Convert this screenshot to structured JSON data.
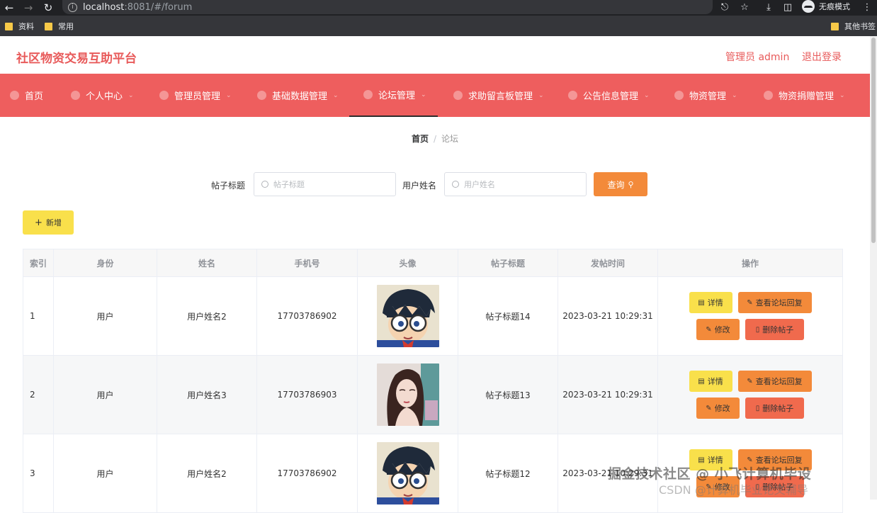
{
  "browser": {
    "url_host": "localhost",
    "url_path": ":8081/#/forum",
    "incognito_label": "无痕模式",
    "bookmarks": [
      "资料",
      "常用"
    ],
    "other_bookmarks": "其他书签"
  },
  "header": {
    "title": "社区物资交易互助平台",
    "admin": "管理员 admin",
    "logout": "退出登录",
    "accent": "#e85a5a"
  },
  "menu": {
    "color": "#ee5e5e",
    "items": [
      {
        "label": "首页",
        "icon": "home-icon"
      },
      {
        "label": "个人中心",
        "icon": "user-icon"
      },
      {
        "label": "管理员管理",
        "icon": "info-circle-icon"
      },
      {
        "label": "基础数据管理",
        "icon": "power-icon"
      },
      {
        "label": "论坛管理",
        "icon": "clock-icon"
      },
      {
        "label": "求助留言板管理",
        "icon": "mobile-icon"
      },
      {
        "label": "公告信息管理",
        "icon": "settings-icon"
      },
      {
        "label": "物资管理",
        "icon": "globe-icon"
      },
      {
        "label": "物资捐赠管理",
        "icon": "lock-icon"
      }
    ],
    "active_index": 4
  },
  "breadcrumb": {
    "home": "首页",
    "sep": "/",
    "current": "论坛"
  },
  "search": {
    "title_label": "帖子标题",
    "title_placeholder": "帖子标题",
    "user_label": "用户姓名",
    "user_placeholder": "用户姓名",
    "query_button": "查询"
  },
  "add_button": "新增",
  "table": {
    "headers": [
      "索引",
      "身份",
      "姓名",
      "手机号",
      "头像",
      "帖子标题",
      "发帖时间",
      "操作"
    ],
    "rows": [
      {
        "index": "1",
        "role": "用户",
        "name": "用户姓名2",
        "phone": "17703786902",
        "avatar": "cartoon-boy",
        "title": "帖子标题14",
        "time": "2023-03-21 10:29:31"
      },
      {
        "index": "2",
        "role": "用户",
        "name": "用户姓名3",
        "phone": "17703786903",
        "avatar": "girl-portrait",
        "title": "帖子标题13",
        "time": "2023-03-21 10:29:31"
      },
      {
        "index": "3",
        "role": "用户",
        "name": "用户姓名2",
        "phone": "17703786902",
        "avatar": "cartoon-boy",
        "title": "帖子标题12",
        "time": "2023-03-21 10:29:31"
      }
    ],
    "ops": {
      "detail": "详情",
      "reply": "查看论坛回复",
      "edit": "修改",
      "delete": "删除帖子"
    }
  },
  "watermark": {
    "line1": "掘金技术社区 @ 小飞计算机毕设",
    "line2": "CSDN @计算机毕业论文辅导"
  }
}
